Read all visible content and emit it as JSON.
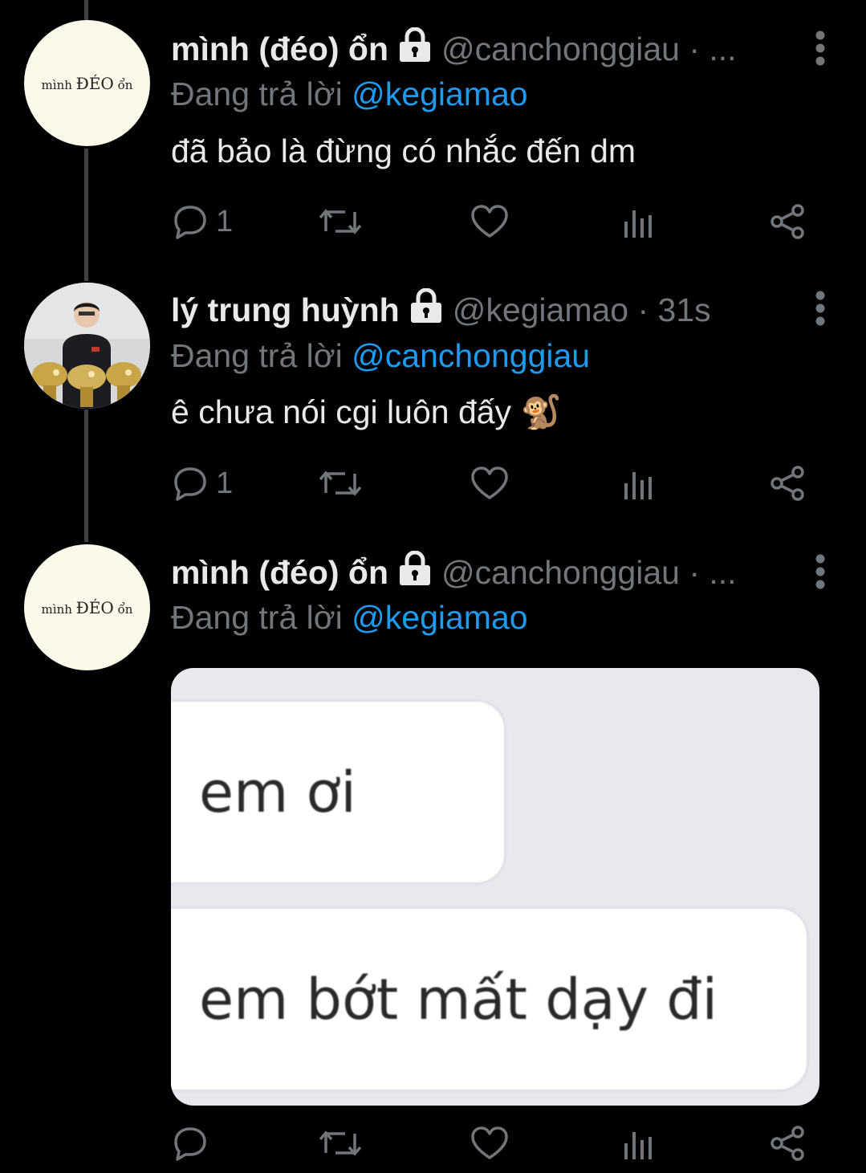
{
  "tweets": [
    {
      "display_name": "mình (đéo) ổn",
      "handle": "@canchonggiau · ...",
      "reply_prefix": "Đang trả lời",
      "reply_to": "@kegiamao",
      "text": "đã bảo là đừng có nhắc đến dm",
      "reply_count": "1",
      "avatar": "text-logo"
    },
    {
      "display_name": "lý trung huỳnh",
      "handle": "@kegiamao · 31s",
      "reply_prefix": "Đang trả lời",
      "reply_to": "@canchonggiau",
      "text": "ê chưa nói cgi luôn đấy 🐒",
      "reply_count": "1",
      "avatar": "person-with-trophies"
    },
    {
      "display_name": "mình (đéo) ổn",
      "handle": "@canchonggiau · ...",
      "reply_prefix": "Đang trả lời",
      "reply_to": "@kegiamao",
      "media": {
        "bubble_1": "em ơi",
        "bubble_2": "em bớt mất dạy đi"
      },
      "avatar": "text-logo"
    }
  ],
  "avatar_logo": {
    "left": "mình",
    "middle": "ĐÉO",
    "right": "ổn"
  },
  "icons": [
    "reply-icon",
    "retweet-icon",
    "like-icon",
    "analytics-icon",
    "share-icon",
    "lock-icon",
    "more-icon"
  ],
  "colors": {
    "background": "#000000",
    "text": "#e7e9ea",
    "secondary": "#71767b",
    "link": "#1d9bf0",
    "thread_line": "#3e4144"
  }
}
